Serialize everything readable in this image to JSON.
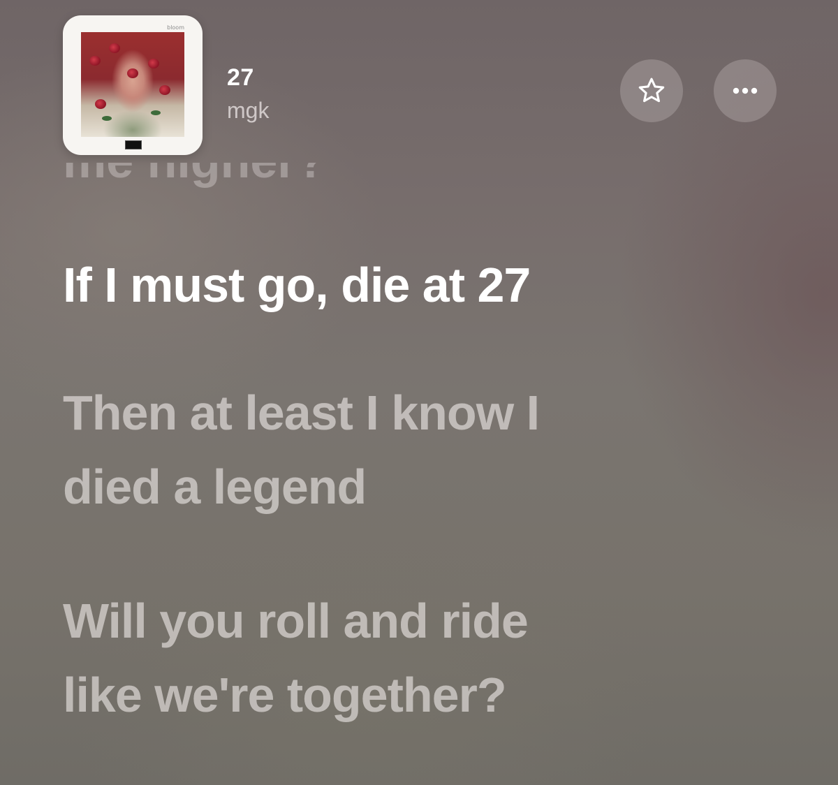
{
  "header": {
    "album_label": "bloom",
    "track_title": "27",
    "artist": "mgk",
    "icons": {
      "favorite": "star-icon",
      "more": "more-icon"
    }
  },
  "lyrics": {
    "previous_partial": "me higher?",
    "current": "If I must go, die at 27",
    "next": [
      {
        "line1": "Then at least I know I",
        "line2": "died a legend"
      },
      {
        "line1": "Will you roll and ride",
        "line2": "like we're together?"
      }
    ]
  },
  "colors": {
    "active_lyric": "#ffffff",
    "inactive_lyric": "#d9d2d0",
    "background": "#77706c"
  }
}
